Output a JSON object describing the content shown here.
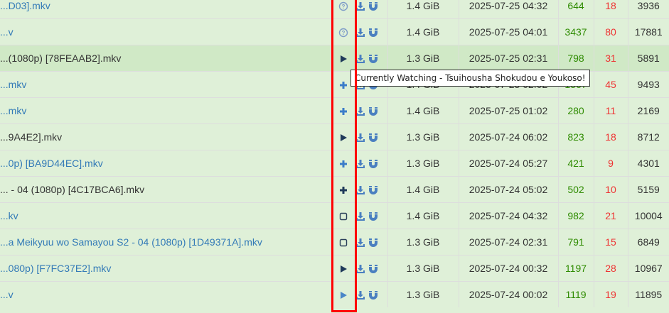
{
  "rows": [
    {
      "title": "...D03].mkv",
      "title_color": "blue",
      "status": "question",
      "status_color": "#7e9cc8",
      "size": "1.4 GiB",
      "date": "2025-07-25 04:32",
      "seeders": "644",
      "leechers": "18",
      "completed": "3936"
    },
    {
      "title": "...v",
      "title_color": "blue",
      "status": "question",
      "status_color": "#7e9cc8",
      "size": "1.4 GiB",
      "date": "2025-07-25 04:01",
      "seeders": "3437",
      "leechers": "80",
      "completed": "17881"
    },
    {
      "title": "...(1080p) [78FEAAB2].mkv",
      "title_color": "dark",
      "status": "play",
      "status_color": "#1f3a5a",
      "size": "1.3 GiB",
      "date": "2025-07-25 02:31",
      "seeders": "798",
      "leechers": "31",
      "completed": "5891",
      "highlight": true
    },
    {
      "title": "...mkv",
      "title_color": "blue",
      "status": "plus",
      "status_color": "#3b7cc9",
      "size": "1.4 GiB",
      "date": "2025-07-25 02:02",
      "seeders": "1567",
      "leechers": "45",
      "completed": "9493"
    },
    {
      "title": "...mkv",
      "title_color": "blue",
      "status": "plus",
      "status_color": "#3b7cc9",
      "size": "1.4 GiB",
      "date": "2025-07-25 01:02",
      "seeders": "280",
      "leechers": "11",
      "completed": "2169"
    },
    {
      "title": "...9A4E2].mkv",
      "title_color": "dark",
      "status": "play",
      "status_color": "#1f3a5a",
      "size": "1.3 GiB",
      "date": "2025-07-24 06:02",
      "seeders": "823",
      "leechers": "18",
      "completed": "8712"
    },
    {
      "title": "...0p) [BA9D44EC].mkv",
      "title_color": "blue",
      "status": "plus",
      "status_color": "#3b7cc9",
      "size": "1.3 GiB",
      "date": "2025-07-24 05:27",
      "seeders": "421",
      "leechers": "9",
      "completed": "4301"
    },
    {
      "title": "... - 04 (1080p) [4C17BCA6].mkv",
      "title_color": "dark",
      "status": "plus",
      "status_color": "#1f3a5a",
      "size": "1.4 GiB",
      "date": "2025-07-24 05:02",
      "seeders": "502",
      "leechers": "10",
      "completed": "5159"
    },
    {
      "title": "...kv",
      "title_color": "blue",
      "status": "square",
      "status_color": "#2a3f5a",
      "size": "1.4 GiB",
      "date": "2025-07-24 04:32",
      "seeders": "982",
      "leechers": "21",
      "completed": "10004"
    },
    {
      "title": "...a Meikyuu wo Samayou S2 - 04 (1080p) [1D49371A].mkv",
      "title_color": "blue",
      "status": "square",
      "status_color": "#2a3f5a",
      "size": "1.3 GiB",
      "date": "2025-07-24 02:31",
      "seeders": "791",
      "leechers": "15",
      "completed": "6849"
    },
    {
      "title": "...080p) [F7FC37E2].mkv",
      "title_color": "blue",
      "status": "play",
      "status_color": "#1f3a5a",
      "size": "1.3 GiB",
      "date": "2025-07-24 00:32",
      "seeders": "1197",
      "leechers": "28",
      "completed": "10967"
    },
    {
      "title": "...v",
      "title_color": "blue",
      "status": "play",
      "status_color": "#4a86c8",
      "size": "1.3 GiB",
      "date": "2025-07-24 00:02",
      "seeders": "1119",
      "leechers": "19",
      "completed": "11895"
    }
  ],
  "tooltip": "Currently Watching - Tsuihousha Shokudou e Youkoso!",
  "colors": {
    "row_bg": "#dff0d8",
    "row_highlight": "#d0e9c6",
    "link": "#337ab7",
    "seeders": "#2e8b00",
    "leechers": "#ee3333",
    "annotation": "#ff0000"
  }
}
